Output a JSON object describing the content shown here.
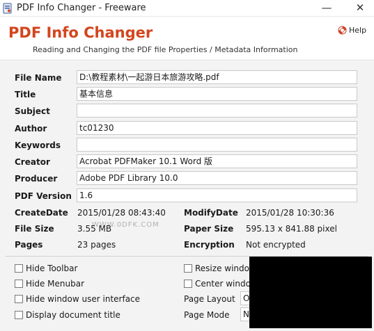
{
  "window": {
    "title": "PDF Info Changer - Freeware",
    "minimize_glyph": "—",
    "close_glyph": "✕"
  },
  "header": {
    "app_title": "PDF Info Changer",
    "tagline": "Reading and Changing the PDF file Properties / Metadata Information",
    "help_label": "Help"
  },
  "fields": [
    {
      "label": "File Name",
      "value": "D:\\教程素材\\一起游日本旅游攻略.pdf"
    },
    {
      "label": "Title",
      "value": "基本信息"
    },
    {
      "label": "Subject",
      "value": ""
    },
    {
      "label": "Author",
      "value": "tc01230"
    },
    {
      "label": "Keywords",
      "value": ""
    },
    {
      "label": "Creator",
      "value": "Acrobat PDFMaker 10.1 Word 版"
    },
    {
      "label": "Producer",
      "value": "Adobe PDF Library 10.0"
    },
    {
      "label": "PDF Version",
      "value": "1.6"
    }
  ],
  "info": {
    "create_date_label": "CreateDate",
    "create_date_value": "2015/01/28 08:43:40",
    "modify_date_label": "ModifyDate",
    "modify_date_value": "2015/01/28 10:30:36",
    "file_size_label": "File Size",
    "file_size_value": "3.55 MB",
    "paper_size_label": "Paper Size",
    "paper_size_value": "595.13 x 841.88 pixel",
    "pages_label": "Pages",
    "pages_value": "23 pages",
    "encryption_label": "Encryption",
    "encryption_value": "Not encrypted"
  },
  "options": {
    "hide_toolbar": "Hide Toolbar",
    "hide_menubar": "Hide Menubar",
    "hide_window_ui": "Hide window user interface",
    "display_doc_title": "Display document title",
    "resize_window": "Resize window",
    "center_window": "Center window",
    "page_layout_label": "Page Layout",
    "page_layout_value": "O",
    "page_mode_label": "Page Mode",
    "page_mode_value": "N"
  },
  "watermark": "WWW.0DFK.COM",
  "colors": {
    "accent": "#d2461e",
    "panel_bg": "#f3f3f3"
  }
}
